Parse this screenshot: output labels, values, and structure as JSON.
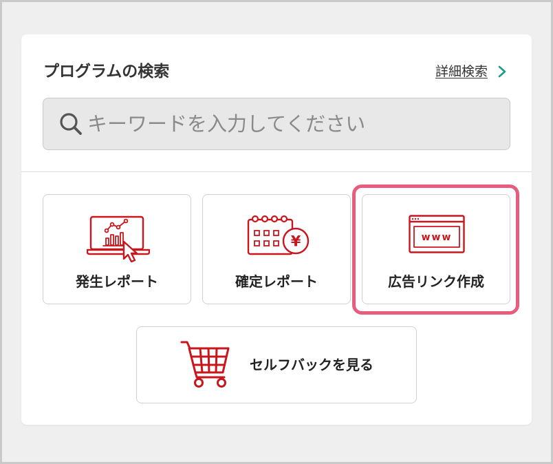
{
  "search_panel": {
    "title": "プログラムの検索",
    "advanced_search": {
      "label": "詳細検索",
      "icon": "chevron-right-icon"
    },
    "search": {
      "placeholder": "キーワードを入力してください",
      "icon": "search-icon"
    }
  },
  "shortcuts": [
    {
      "label": "発生レポート",
      "icon": "laptop-chart-icon"
    },
    {
      "label": "確定レポート",
      "icon": "calendar-yen-icon",
      "icon_text": "¥"
    },
    {
      "label": "広告リンク作成",
      "icon": "browser-www-icon",
      "icon_text": "www",
      "highlighted": true
    },
    {
      "label": "セルフバックを見る",
      "icon": "shopping-cart-icon"
    }
  ],
  "colors": {
    "icon_accent": "#c8161d",
    "chevron": "#1a9c8c",
    "highlight_frame": "#e85d7d",
    "page_background": "#efefef",
    "card_background": "#ffffff",
    "search_background": "#e8e8e8",
    "text": "#333333"
  }
}
